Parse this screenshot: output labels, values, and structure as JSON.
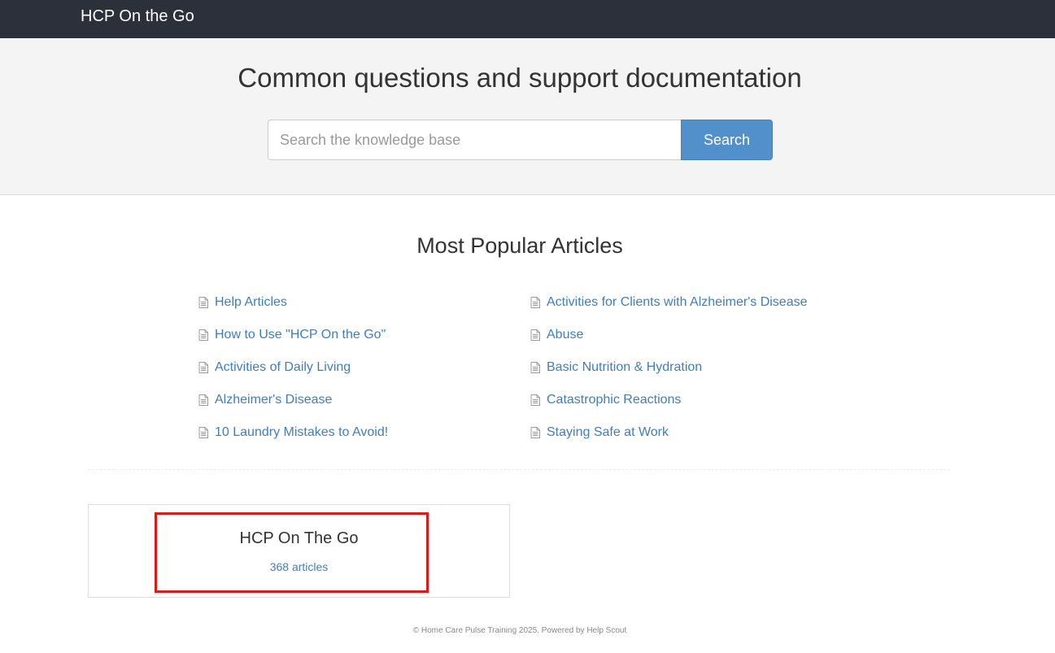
{
  "navbar": {
    "brand": "HCP On the Go"
  },
  "hero": {
    "title": "Common questions and support documentation",
    "search_placeholder": "Search the knowledge base",
    "search_button": "Search"
  },
  "popular": {
    "title": "Most Popular Articles",
    "left_articles": [
      "Help Articles",
      "How to Use \"HCP On the Go\"",
      "Activities of Daily Living",
      "Alzheimer's Disease",
      "10 Laundry Mistakes to Avoid!"
    ],
    "right_articles": [
      "Activities for Clients with Alzheimer's Disease",
      "Abuse",
      "Basic Nutrition & Hydration",
      "Catastrophic Reactions",
      "Staying Safe at Work"
    ],
    "item_icon": "document-icon"
  },
  "category": {
    "title": "HCP On The Go",
    "count": "368 articles"
  },
  "footer": {
    "text": "© Home Care Pulse Training 2025. Powered by Help Scout"
  },
  "colors": {
    "navbar": "#2b303a",
    "accent": "#5190cb",
    "link": "#3f7fb8",
    "highlight": "#d71c1c"
  }
}
